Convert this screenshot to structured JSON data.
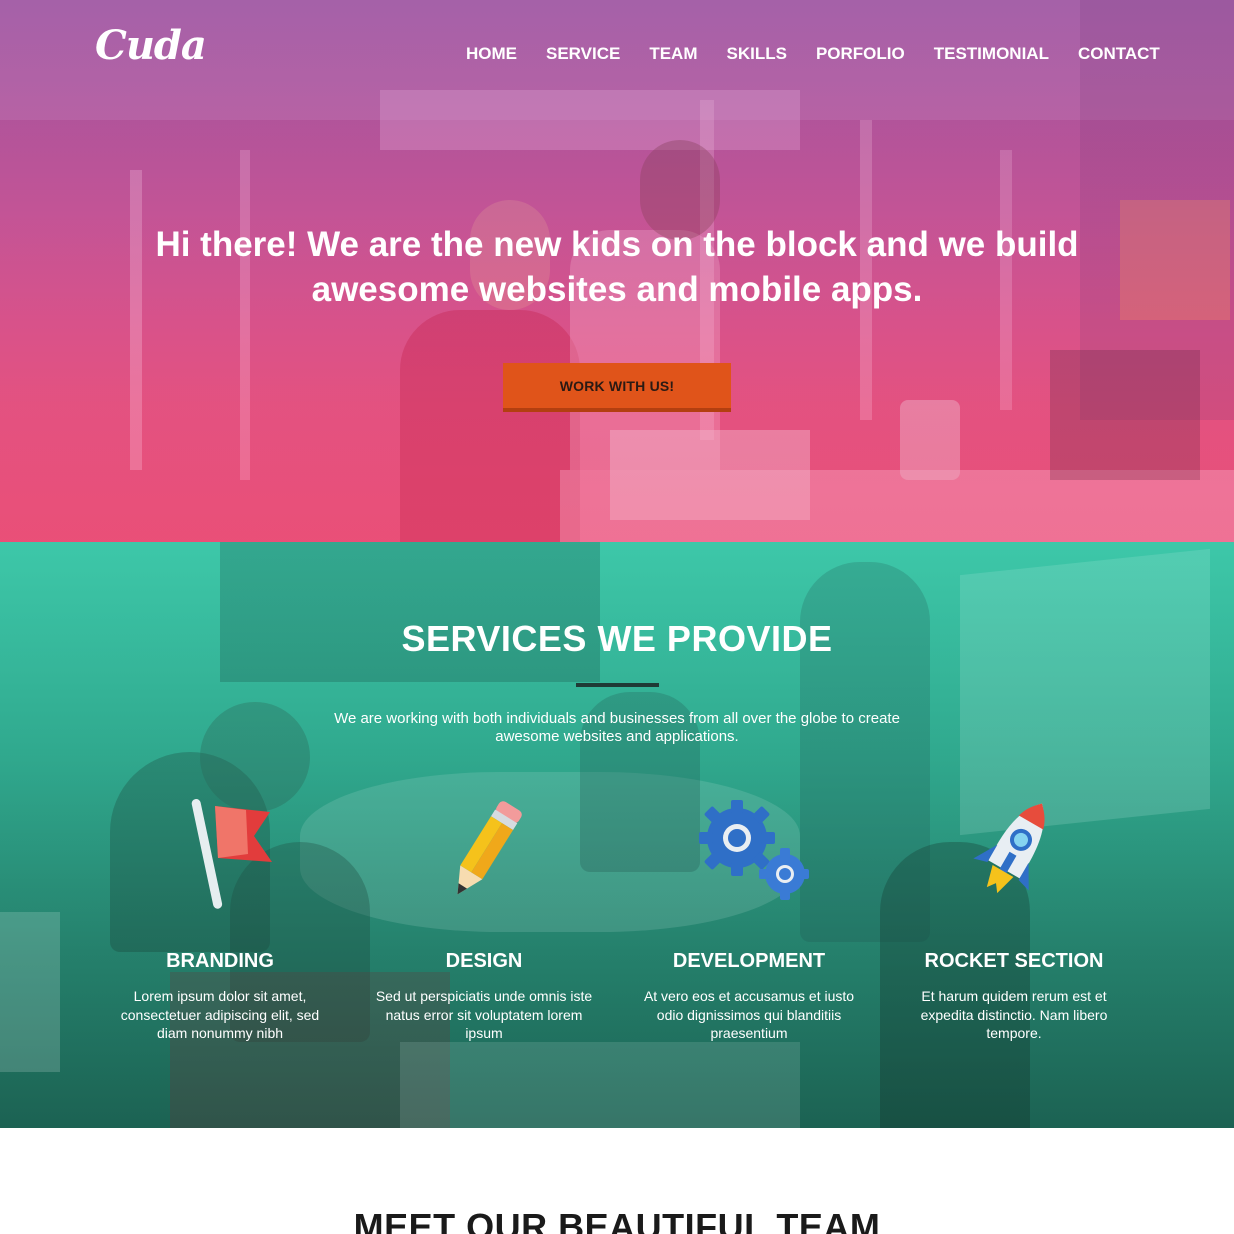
{
  "brand": {
    "logo": "Cuda"
  },
  "nav": {
    "items": [
      "HOME",
      "SERVICE",
      "TEAM",
      "SKILLS",
      "PORFOLIO",
      "TESTIMONIAL",
      "CONTACT"
    ]
  },
  "hero": {
    "title": "Hi there! We are the new kids on the block and we build awesome websites and mobile apps.",
    "cta_label": "WORK WITH US!"
  },
  "services": {
    "title": "SERVICES WE PROVIDE",
    "subtitle": "We are working with both individuals and businesses from all over the globe to create awesome websites and applications.",
    "items": [
      {
        "icon": "flag-icon",
        "title": "BRANDING",
        "description": "Lorem ipsum dolor sit amet, consectetuer adipiscing elit, sed diam nonummy nibh"
      },
      {
        "icon": "pencil-icon",
        "title": "DESIGN",
        "description": "Sed ut perspiciatis unde omnis iste natus error sit voluptatem lorem ipsum"
      },
      {
        "icon": "gears-icon",
        "title": "DEVELOPMENT",
        "description": "At vero eos et accusamus et iusto odio dignissimos qui blanditiis praesentium"
      },
      {
        "icon": "rocket-icon",
        "title": "ROCKET SECTION",
        "description": "Et harum quidem rerum est et expedita distinctio. Nam libero tempore."
      }
    ]
  },
  "team": {
    "title": "MEET OUR BEAUTIFUL TEAM"
  },
  "colors": {
    "hero_top": "#a0559f",
    "hero_bottom": "#e84f78",
    "cta": "#e0541a",
    "services_top": "#3ec7a8",
    "services_bottom": "#1b5e50"
  }
}
